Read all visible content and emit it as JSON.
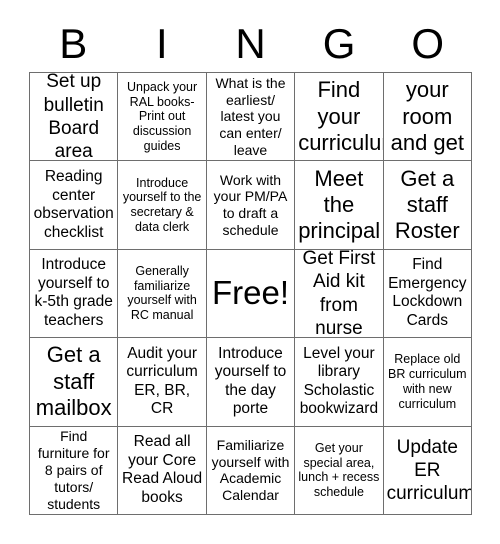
{
  "header": {
    "letters": [
      "B",
      "I",
      "N",
      "G",
      "O"
    ]
  },
  "grid": {
    "rows": 5,
    "columns": 5,
    "border_color": "#6e6e6e",
    "background_color": "#ffffff",
    "text_color": "#000000",
    "cells": [
      {
        "text": "Set up bulletin Board area",
        "size": "l"
      },
      {
        "text": "Unpack your RAL books- Print out discussion guides",
        "size": "xs"
      },
      {
        "text": "What is the earliest/ latest you can enter/ leave",
        "size": "s"
      },
      {
        "text": "Find your curriculum",
        "size": "xl"
      },
      {
        "text": "Find your room and get a key!",
        "size": "xl"
      },
      {
        "text": "Reading center observation checklist",
        "size": "m"
      },
      {
        "text": "Introduce yourself to the secretary & data clerk",
        "size": "xs"
      },
      {
        "text": "Work with your PM/PA to draft a schedule",
        "size": "s"
      },
      {
        "text": "Meet the principal",
        "size": "xl"
      },
      {
        "text": "Get a staff Roster",
        "size": "xl"
      },
      {
        "text": "Introduce yourself to k-5th grade teachers",
        "size": "m"
      },
      {
        "text": "Generally familiarize yourself with RC manual",
        "size": "xs"
      },
      {
        "text": "Free!",
        "size": "free"
      },
      {
        "text": "Get First Aid kit from nurse",
        "size": "l"
      },
      {
        "text": "Find Emergency Lockdown Cards",
        "size": "m"
      },
      {
        "text": "Get a staff mailbox",
        "size": "xl"
      },
      {
        "text": "Audit your curriculum ER, BR, CR",
        "size": "m"
      },
      {
        "text": "Introduce yourself to the day porte",
        "size": "m"
      },
      {
        "text": "Level your library Scholastic bookwizard",
        "size": "m"
      },
      {
        "text": "Replace old BR curriculum with new curriculum",
        "size": "xs"
      },
      {
        "text": "Find furniture for 8 pairs of tutors/ students",
        "size": "s"
      },
      {
        "text": "Read all your Core Read Aloud books",
        "size": "m"
      },
      {
        "text": "Familiarize yourself with Academic Calendar",
        "size": "s"
      },
      {
        "text": "Get your special area, lunch + recess schedule",
        "size": "xs"
      },
      {
        "text": "Update ER curriculum",
        "size": "l"
      }
    ]
  }
}
